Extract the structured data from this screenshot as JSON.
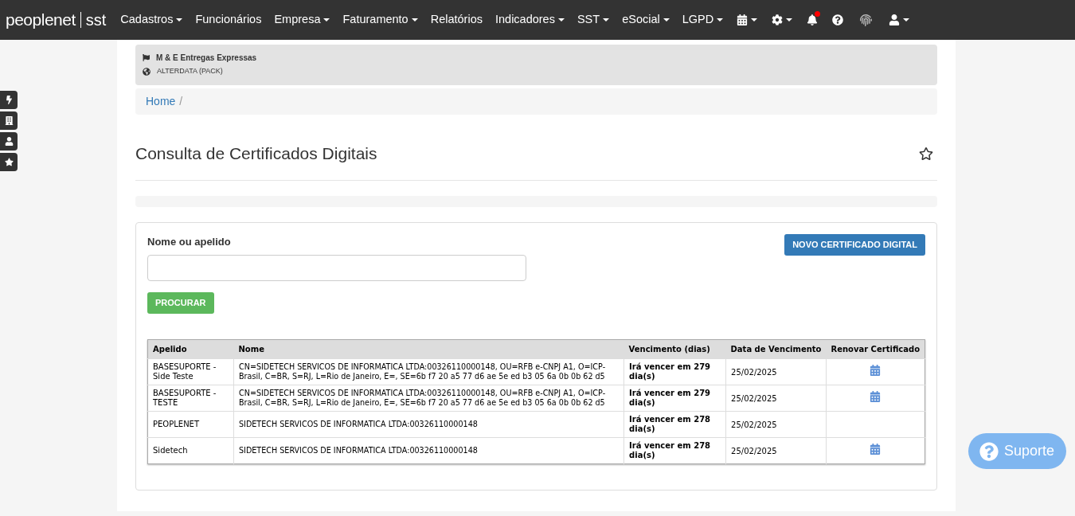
{
  "brand": {
    "name": "peoplenet",
    "product": "sst"
  },
  "nav": [
    {
      "label": "Cadastros",
      "dropdown": true
    },
    {
      "label": "Funcionários",
      "dropdown": false
    },
    {
      "label": "Empresa",
      "dropdown": true
    },
    {
      "label": "Faturamento",
      "dropdown": true
    },
    {
      "label": "Relatórios",
      "dropdown": false
    },
    {
      "label": "Indicadores",
      "dropdown": true
    },
    {
      "label": "SST",
      "dropdown": true
    },
    {
      "label": "eSocial",
      "dropdown": true
    },
    {
      "label": "LGPD",
      "dropdown": true
    }
  ],
  "company": {
    "name": "M & E Entregas Expressas",
    "group": "ALTERDATA (PACK)"
  },
  "breadcrumb": [
    {
      "label": "Home",
      "separator": "/"
    }
  ],
  "page_title": "Consulta de Certificados Digitais",
  "search": {
    "label": "Nome ou apelido"
  },
  "buttons": {
    "search": "PROCURAR",
    "new": "NOVO CERTIFICADO DIGITAL"
  },
  "table": {
    "columns": [
      "Apelido",
      "Nome",
      "Vencimento (dias)",
      "Data de Vencimento",
      "Renovar Certificado"
    ],
    "rows": [
      {
        "alias": "BASESUPORTE - Side Teste",
        "name": "CN=SIDETECH SERVICOS DE INFORMATICA LTDA:00326110000148, OU=RFB e-CNPJ A1, O=ICP-Brasil, C=BR, S=RJ, L=Rio de Janeiro, E=, SE=6b f7 20 a5 77 d6 ae 5e ed b3 05 6a 0b 0b 62 d5",
        "expiry": "Irá vencer em 279 dia(s)",
        "date": "25/02/2025",
        "renewable": true
      },
      {
        "alias": "BASESUPORTE - TESTE",
        "name": "CN=SIDETECH SERVICOS DE INFORMATICA LTDA:00326110000148, OU=RFB e-CNPJ A1, O=ICP-Brasil, C=BR, S=RJ, L=Rio de Janeiro, E=, SE=6b f7 20 a5 77 d6 ae 5e ed b3 05 6a 0b 0b 62 d5",
        "expiry": "Irá vencer em 279 dia(s)",
        "date": "25/02/2025",
        "renewable": true
      },
      {
        "alias": "PEOPLENET",
        "name": "SIDETECH SERVICOS DE INFORMATICA LTDA:00326110000148",
        "expiry": "Irá vencer em 278 dia(s)",
        "date": "25/02/2025",
        "renewable": false
      },
      {
        "alias": "Sidetech",
        "name": "SIDETECH SERVICOS DE INFORMATICA LTDA:00326110000148",
        "expiry": "Irá vencer em 278 dia(s)",
        "date": "25/02/2025",
        "renewable": true
      }
    ]
  },
  "support": "Suporte"
}
